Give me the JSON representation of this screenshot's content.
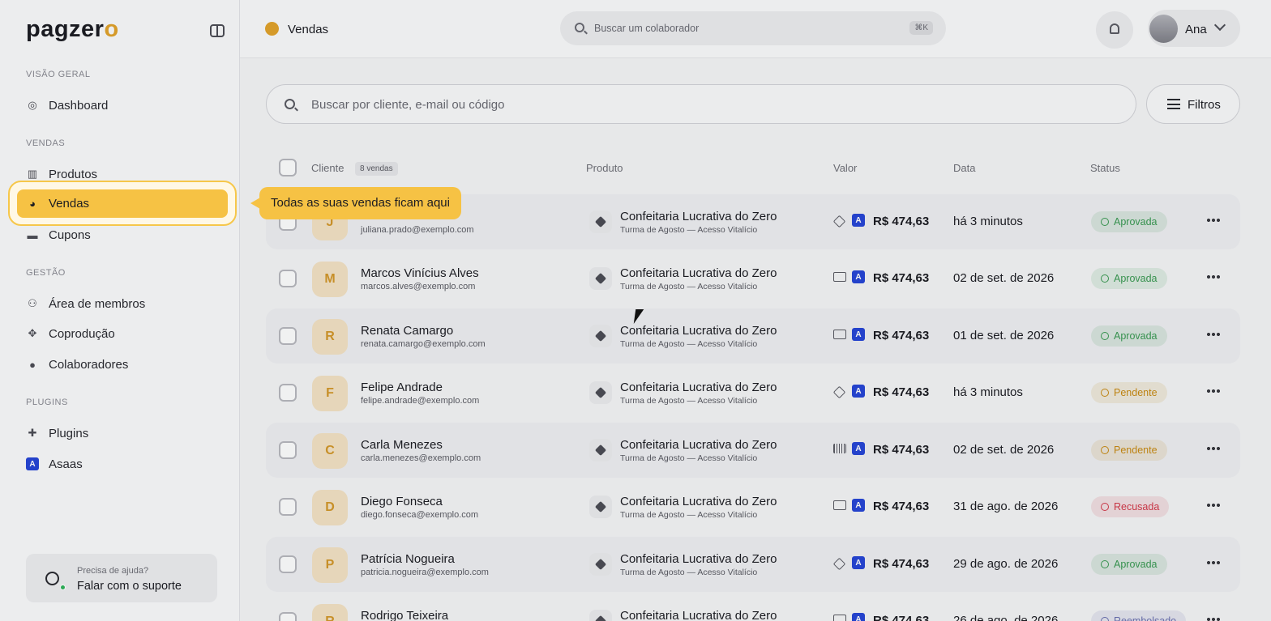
{
  "brand": {
    "logo": "pagzero"
  },
  "sidebar": {
    "sections": [
      "VISÃO GERAL",
      "VENDAS",
      "GESTÃO",
      "PLUGINS"
    ],
    "items": [
      {
        "label": "Dashboard",
        "icon": "dashboard-icon"
      },
      {
        "label": "Produtos",
        "icon": "products-icon"
      },
      {
        "label": "Vendas",
        "icon": "sales-icon",
        "active": true
      },
      {
        "label": "Cupons",
        "icon": "coupon-icon"
      },
      {
        "label": "Área de membros",
        "icon": "members-icon"
      },
      {
        "label": "Coprodução",
        "icon": "handshake-icon"
      },
      {
        "label": "Colaboradores",
        "icon": "users-icon"
      },
      {
        "label": "Plugins",
        "icon": "puzzle-icon"
      },
      {
        "label": "Asaas",
        "icon": "asaas-icon"
      }
    ],
    "help": {
      "title": "Precisa de ajuda?",
      "action": "Falar com o suporte"
    }
  },
  "topbar": {
    "title": "Vendas",
    "search_placeholder": "Buscar um colaborador",
    "shortcut": "⌘K",
    "user": "Ana"
  },
  "search": {
    "placeholder": "Buscar por cliente, e-mail ou código"
  },
  "filters": {
    "label": "Filtros"
  },
  "tooltip": {
    "text": "Todas as suas vendas ficam aqui"
  },
  "table": {
    "headers": {
      "client": "Cliente",
      "count": "8 vendas",
      "product": "Produto",
      "value": "Valor",
      "date": "Data",
      "status": "Status"
    },
    "rows": [
      {
        "initial": "J",
        "name": "",
        "email": "juliana.prado@exemplo.com",
        "product": "Confeitaria Lucrativa do Zero",
        "variant": "Turma de Agosto — Acesso Vitalício",
        "method": "pix",
        "value": "R$ 474,63",
        "date": "há 3 minutos",
        "status": "Aprovada",
        "status_color": "#3a9a52"
      },
      {
        "initial": "M",
        "name": "Marcos Vinícius Alves",
        "email": "marcos.alves@exemplo.com",
        "product": "Confeitaria Lucrativa do Zero",
        "variant": "Turma de Agosto — Acesso Vitalício",
        "method": "card",
        "value": "R$ 474,63",
        "date": "02 de set. de 2026",
        "status": "Aprovada",
        "status_color": "#3a9a52"
      },
      {
        "initial": "R",
        "name": "Renata Camargo",
        "email": "renata.camargo@exemplo.com",
        "product": "Confeitaria Lucrativa do Zero",
        "variant": "Turma de Agosto — Acesso Vitalício",
        "method": "card",
        "value": "R$ 474,63",
        "date": "01 de set. de 2026",
        "status": "Aprovada",
        "status_color": "#3a9a52"
      },
      {
        "initial": "F",
        "name": "Felipe Andrade",
        "email": "felipe.andrade@exemplo.com",
        "product": "Confeitaria Lucrativa do Zero",
        "variant": "Turma de Agosto — Acesso Vitalício",
        "method": "pix",
        "value": "R$ 474,63",
        "date": "há 3 minutos",
        "status": "Pendente",
        "status_color": "#c98a12"
      },
      {
        "initial": "C",
        "name": "Carla Menezes",
        "email": "carla.menezes@exemplo.com",
        "product": "Confeitaria Lucrativa do Zero",
        "variant": "Turma de Agosto — Acesso Vitalício",
        "method": "boleto",
        "value": "R$ 474,63",
        "date": "02 de set. de 2026",
        "status": "Pendente",
        "status_color": "#c98a12"
      },
      {
        "initial": "D",
        "name": "Diego Fonseca",
        "email": "diego.fonseca@exemplo.com",
        "product": "Confeitaria Lucrativa do Zero",
        "variant": "Turma de Agosto — Acesso Vitalício",
        "method": "card",
        "value": "R$ 474,63",
        "date": "31 de ago. de 2026",
        "status": "Recusada",
        "status_color": "#d4394a"
      },
      {
        "initial": "P",
        "name": "Patrícia Nogueira",
        "email": "patricia.nogueira@exemplo.com",
        "product": "Confeitaria Lucrativa do Zero",
        "variant": "Turma de Agosto — Acesso Vitalício",
        "method": "pix",
        "value": "R$ 474,63",
        "date": "29 de ago. de 2026",
        "status": "Aprovada",
        "status_color": "#3a9a52"
      },
      {
        "initial": "R",
        "name": "Rodrigo Teixeira",
        "email": "",
        "product": "Confeitaria Lucrativa do Zero",
        "variant": "",
        "method": "card",
        "value": "R$ 474,63",
        "date": "26 de ago. de 2026",
        "status": "Reembolsado",
        "status_color": "#6a6fb0"
      }
    ]
  },
  "colors": {
    "accent": "#f6c244",
    "brand_blue": "#2746d7"
  }
}
